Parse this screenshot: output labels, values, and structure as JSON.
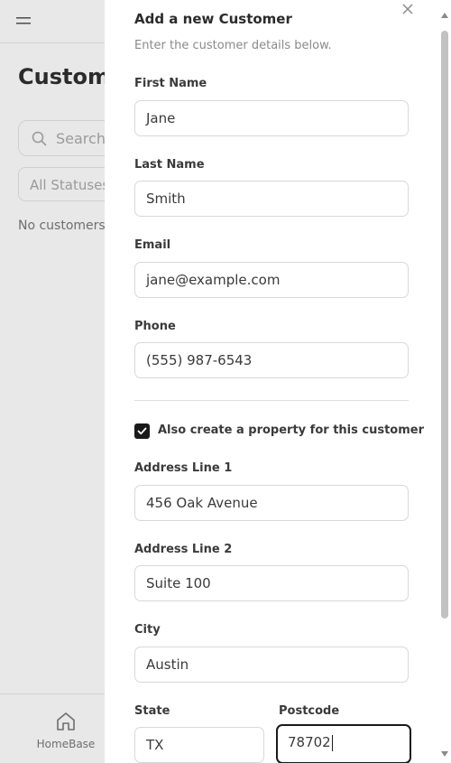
{
  "background": {
    "page_title": "Custome",
    "search_placeholder": "Search",
    "status_filter": "All Statuses",
    "empty_message": "No customers f",
    "nav": {
      "home_label": "HomeBase"
    }
  },
  "sheet": {
    "title": "Add a new Customer",
    "subtitle": "Enter the customer details below.",
    "fields": {
      "first_name": {
        "label": "First Name",
        "value": "Jane"
      },
      "last_name": {
        "label": "Last Name",
        "value": "Smith"
      },
      "email": {
        "label": "Email",
        "value": "jane@example.com"
      },
      "phone": {
        "label": "Phone",
        "value": "(555) 987-6543"
      },
      "address1": {
        "label": "Address Line 1",
        "value": "456 Oak Avenue"
      },
      "address2": {
        "label": "Address Line 2",
        "value": "Suite 100"
      },
      "city": {
        "label": "City",
        "value": "Austin"
      },
      "state": {
        "label": "State",
        "value": "TX"
      },
      "postcode": {
        "label": "Postcode",
        "value": "78702"
      }
    },
    "create_property": {
      "label": "Also create a property for this customer",
      "checked": true
    }
  },
  "icons": {
    "menu": "menu-icon",
    "search": "search-icon",
    "home": "home-icon",
    "close": "close-icon",
    "check": "check-icon"
  },
  "colors": {
    "accent": "#1a1a1a",
    "overlay": "#e8e8e8",
    "sheet_bg": "#ffffff"
  }
}
